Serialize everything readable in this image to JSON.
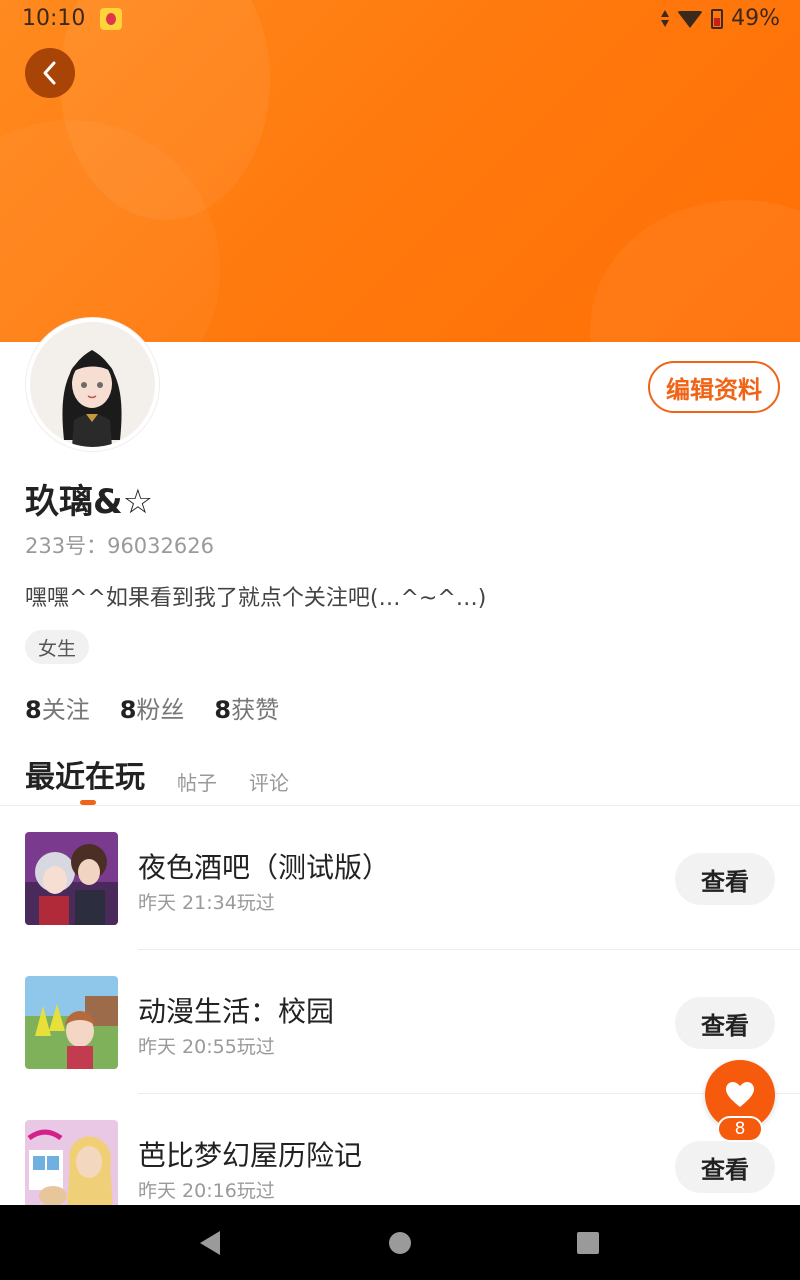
{
  "status_bar": {
    "time": "10:10",
    "battery": "49%"
  },
  "profile": {
    "edit_label": "编辑资料",
    "username": "玖璃&☆",
    "user_id": "233号：96032626",
    "bio": "嘿嘿^^如果看到我了就点个关注吧(…^~^…)",
    "gender": "女生"
  },
  "stats": [
    {
      "value": "8",
      "label": "关注"
    },
    {
      "value": "8",
      "label": "粉丝"
    },
    {
      "value": "8",
      "label": "获赞"
    }
  ],
  "tabs": [
    {
      "label": "最近在玩",
      "active": true
    },
    {
      "label": "帖子",
      "active": false
    },
    {
      "label": "评论",
      "active": false
    }
  ],
  "games": [
    {
      "title": "夜色酒吧（测试版）",
      "time": "昨天 21:34玩过",
      "button": "查看"
    },
    {
      "title": "动漫生活：校园",
      "time": "昨天 20:55玩过",
      "button": "查看"
    },
    {
      "title": "芭比梦幻屋历险记",
      "time": "昨天 20:16玩过",
      "button": "查看"
    }
  ],
  "like": {
    "count": "8"
  },
  "colors": {
    "accent": "#f06418",
    "banner": "#ff7a0e"
  }
}
